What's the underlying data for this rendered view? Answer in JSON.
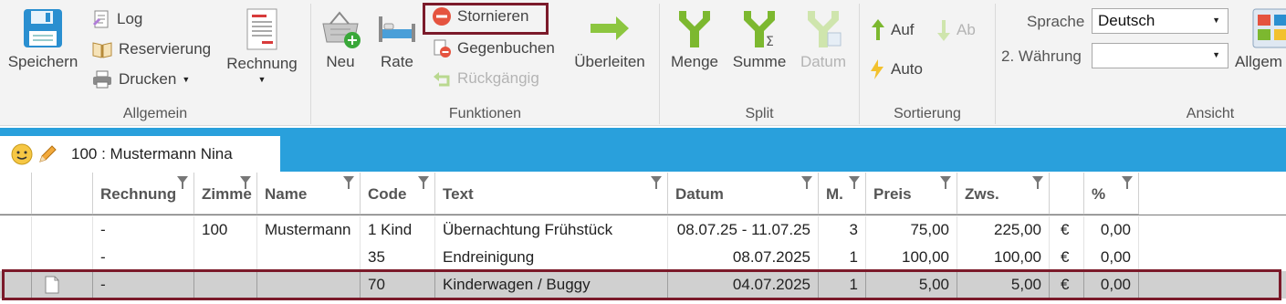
{
  "ribbon": {
    "allgemein": {
      "label": "Allgemein",
      "speichern": "Speichern",
      "log": "Log",
      "reservierung": "Reservierung",
      "drucken": "Drucken",
      "rechnung": "Rechnung"
    },
    "funktionen": {
      "label": "Funktionen",
      "neu": "Neu",
      "rate": "Rate",
      "stornieren": "Stornieren",
      "gegenbuchen": "Gegenbuchen",
      "rueckgaengig": "Rückgängig",
      "ueberleiten": "Überleiten"
    },
    "split": {
      "label": "Split",
      "menge": "Menge",
      "summe": "Summe",
      "datum": "Datum"
    },
    "sortierung": {
      "label": "Sortierung",
      "auf": "Auf",
      "ab": "Ab",
      "auto": "Auto"
    },
    "ansicht": {
      "label": "Ansicht",
      "sprache_label": "Sprache",
      "sprache_value": "Deutsch",
      "waehrung_label": "2. Währung",
      "waehrung_value": "",
      "allgemein": "Allgem"
    }
  },
  "tab": {
    "title": "100 :  Mustermann Nina"
  },
  "table": {
    "headers": {
      "rechnung": "Rechnung",
      "zimmer": "Zimme",
      "name": "Name",
      "code": "Code",
      "text": "Text",
      "datum": "Datum",
      "m": "M.",
      "preis": "Preis",
      "zws": "Zws.",
      "cur": "",
      "pct": "%"
    },
    "rows": [
      {
        "rechnung": "-",
        "zimmer": "100",
        "name": "Mustermann",
        "code": "1 Kind",
        "text": "Übernachtung Frühstück",
        "datum": "08.07.25 - 11.07.25",
        "m": "3",
        "preis": "75,00",
        "zws": "225,00",
        "cur": "€",
        "pct": "0,00"
      },
      {
        "rechnung": "-",
        "zimmer": "",
        "name": "",
        "code": "35",
        "text": "Endreinigung",
        "datum": "08.07.2025",
        "m": "1",
        "preis": "100,00",
        "zws": "100,00",
        "cur": "€",
        "pct": "0,00"
      },
      {
        "rechnung": "-",
        "zimmer": "",
        "name": "",
        "code": "70",
        "text": "Kinderwagen / Buggy",
        "datum": "04.07.2025",
        "m": "1",
        "preis": "5,00",
        "zws": "5,00",
        "cur": "€",
        "pct": "0,00"
      }
    ]
  },
  "colors": {
    "tabstrip": "#29a0dc",
    "highlight": "#7b1a2a",
    "green_icon": "#7cb82f",
    "selected_row": "#d0d0d0"
  }
}
